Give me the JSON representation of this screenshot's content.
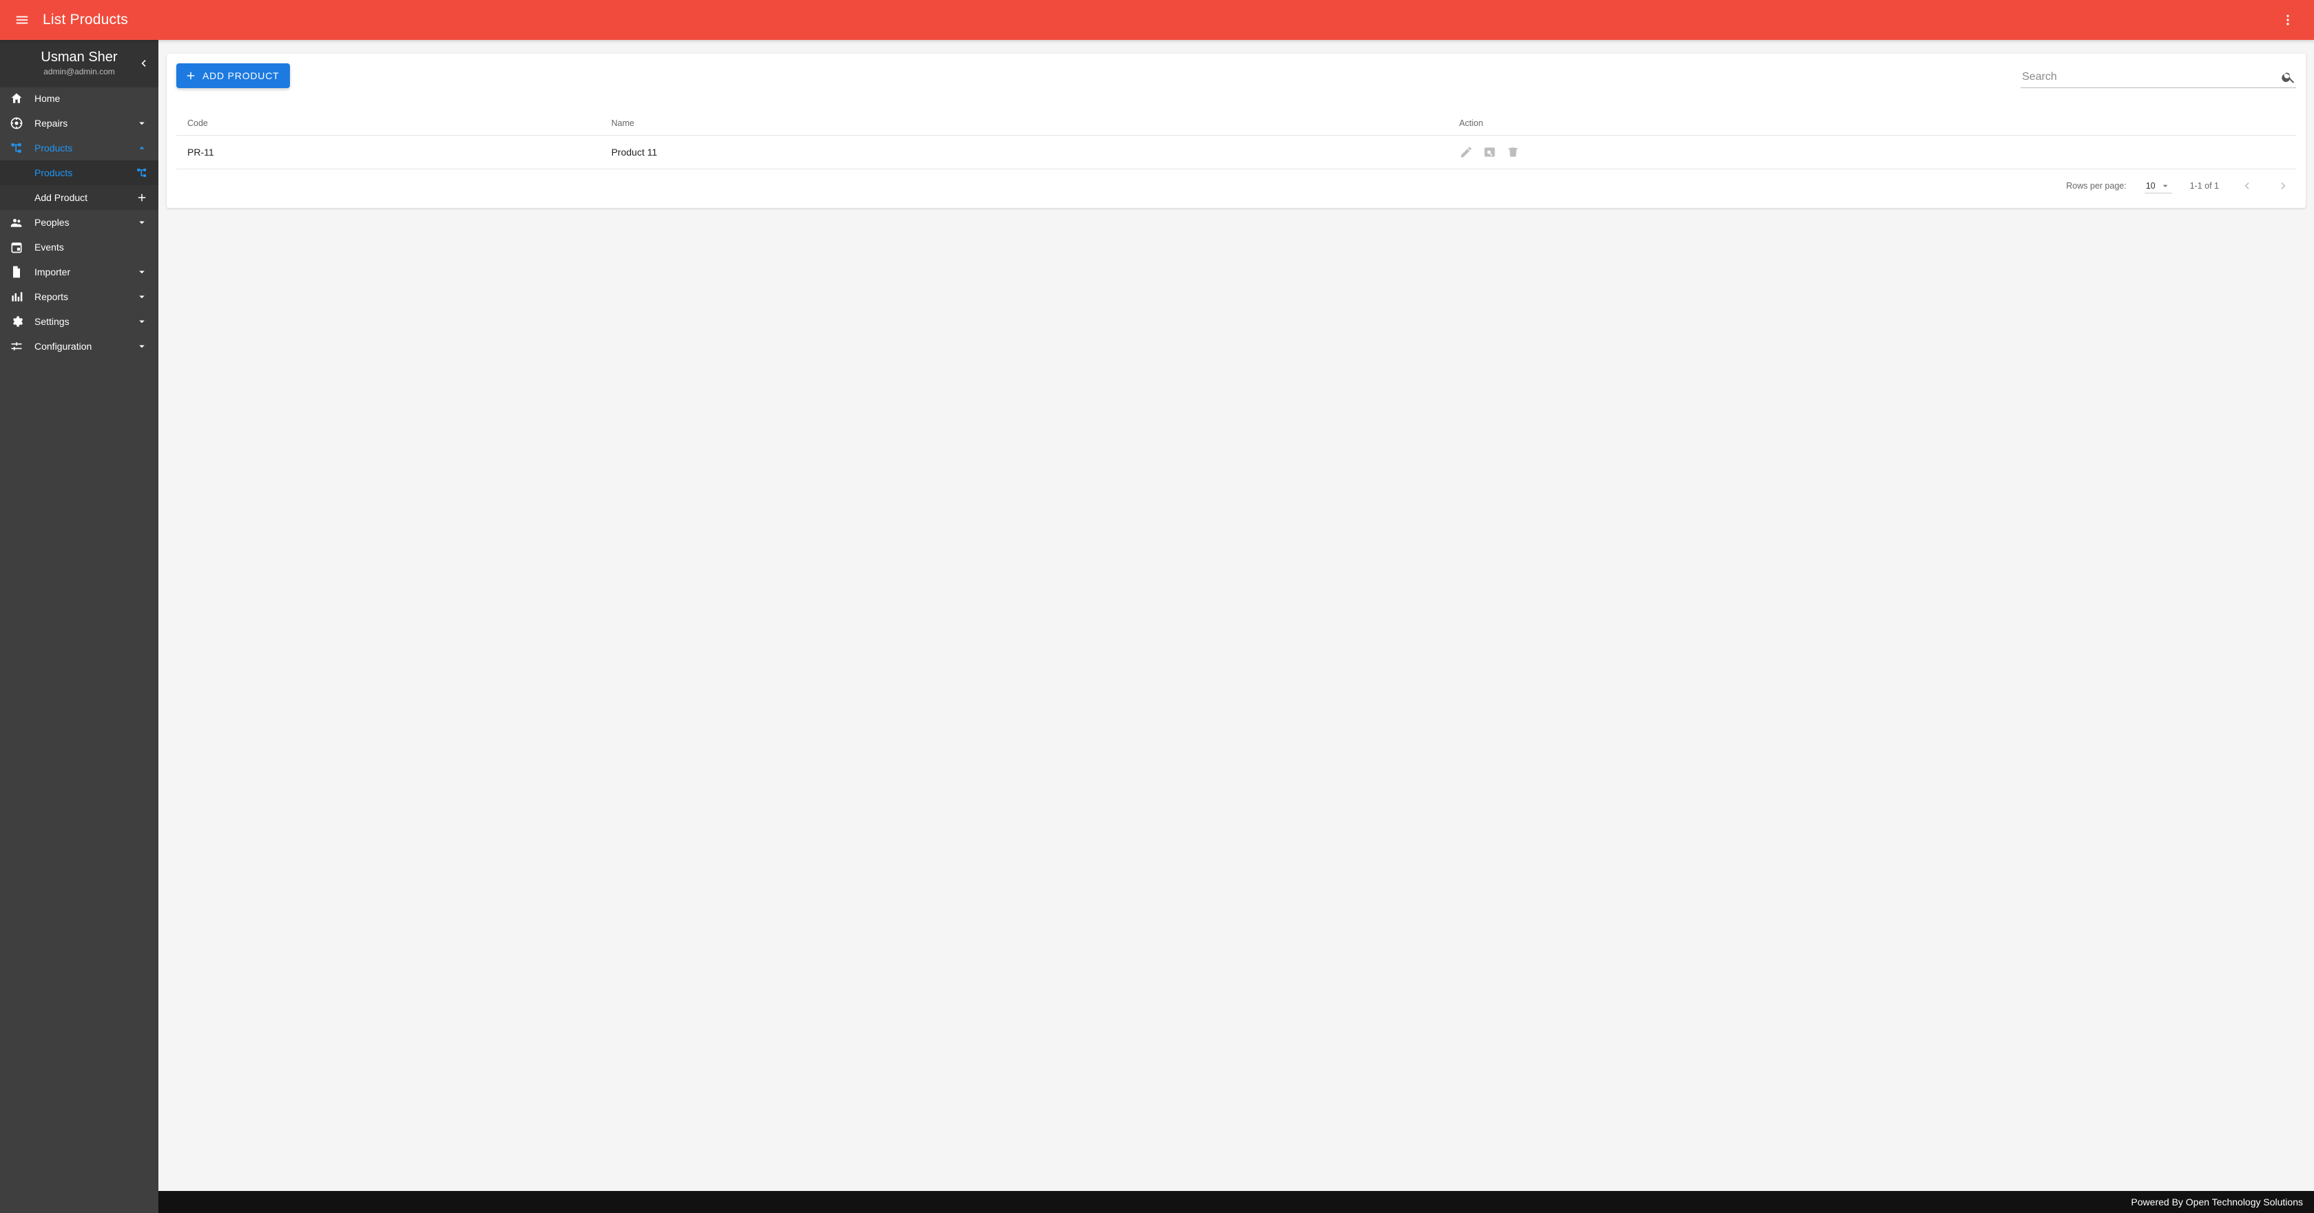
{
  "app": {
    "title": "List Products"
  },
  "user": {
    "name": "Usman Sher",
    "email": "admin@admin.com"
  },
  "sidebar": {
    "items": [
      {
        "label": "Home",
        "icon": "home",
        "expandable": false
      },
      {
        "label": "Repairs",
        "icon": "support",
        "expandable": true,
        "open": false
      },
      {
        "label": "Products",
        "icon": "tree",
        "expandable": true,
        "open": true,
        "active": true,
        "children": [
          {
            "label": "Products",
            "icon": "tree",
            "selected": true
          },
          {
            "label": "Add Product",
            "icon": "plus"
          }
        ]
      },
      {
        "label": "Peoples",
        "icon": "group",
        "expandable": true,
        "open": false
      },
      {
        "label": "Events",
        "icon": "event",
        "expandable": false
      },
      {
        "label": "Importer",
        "icon": "file",
        "expandable": true,
        "open": false
      },
      {
        "label": "Reports",
        "icon": "chart",
        "expandable": true,
        "open": false
      },
      {
        "label": "Settings",
        "icon": "gear",
        "expandable": true,
        "open": false
      },
      {
        "label": "Configuration",
        "icon": "tune",
        "expandable": true,
        "open": false
      }
    ]
  },
  "toolbar": {
    "add_label": "ADD PRODUCT",
    "search_placeholder": "Search",
    "search_value": ""
  },
  "table": {
    "columns": [
      "Code",
      "Name",
      "Action"
    ],
    "rows": [
      {
        "code": "PR-11",
        "name": "Product 11"
      }
    ]
  },
  "pagination": {
    "rows_per_page_label": "Rows per page:",
    "rows_per_page_value": "10",
    "range_label": "1-1 of 1"
  },
  "footer": {
    "text": "Powered By Open Technology Solutions"
  },
  "colors": {
    "brand": "#f14b3d",
    "blue": "#1c7ae0",
    "blue_accent": "#2196f3"
  }
}
